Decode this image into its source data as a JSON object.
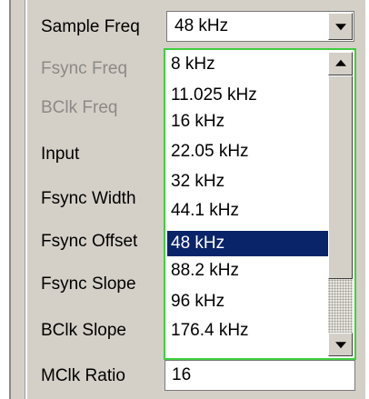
{
  "labels": {
    "sample_freq": "Sample Freq",
    "fsync_freq": "Fsync Freq",
    "bclk_freq": "BClk Freq",
    "input": "Input",
    "fsync_width": "Fsync Width",
    "fsync_offset": "Fsync Offset",
    "fsync_slope": "Fsync Slope",
    "bclk_slope": "BClk Slope",
    "mclk_ratio": "MClk Ratio"
  },
  "sample_freq_combo": {
    "selected": "48 kHz",
    "options": [
      "8 kHz",
      "11.025 kHz",
      "16 kHz",
      "22.05 kHz",
      "32 kHz",
      "44.1 kHz",
      "48 kHz",
      "88.2 kHz",
      "96 kHz",
      "176.4 kHz"
    ],
    "selected_index": 6
  },
  "mclk_ratio_value": "16",
  "colors": {
    "panel": "#d4d0c8",
    "selection": "#0a246a",
    "focus_border": "#3fce3f",
    "disabled_text": "#8c8a86"
  },
  "icons": {
    "combo_button": "chevron-down-icon",
    "scroll_up": "arrow-up-icon",
    "scroll_down": "arrow-down-icon"
  }
}
